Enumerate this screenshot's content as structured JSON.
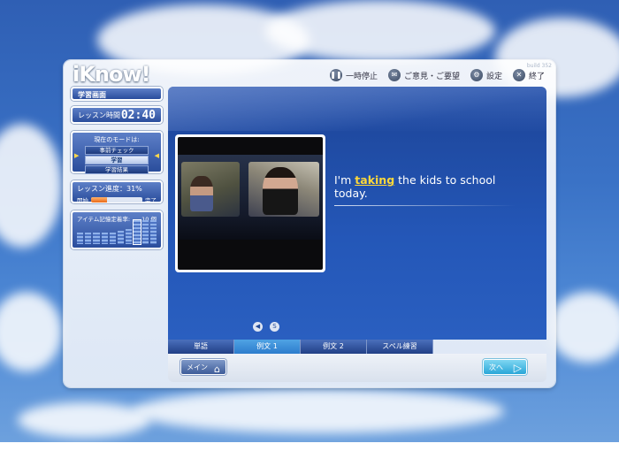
{
  "app": {
    "logo": "iKnow!",
    "build": "build 352"
  },
  "toolbar": [
    {
      "icon": "pause-icon",
      "glyph": "❚❚",
      "label": "一時停止"
    },
    {
      "icon": "feedback-icon",
      "glyph": "✉",
      "label": "ご意見・ご要望"
    },
    {
      "icon": "settings-icon",
      "glyph": "⚙",
      "label": "設定"
    },
    {
      "icon": "exit-icon",
      "glyph": "✕",
      "label": "終了"
    }
  ],
  "sidebar": {
    "title": "学習画面",
    "lesson_time_label": "レッスン時間",
    "lesson_time": "02:40",
    "mode_label": "現在のモードは:",
    "modes": [
      "事前チェック",
      "学習",
      "学習結果"
    ],
    "active_mode": 1,
    "progress_label": "レッスン進度：31%",
    "progress_percent": 31,
    "progress_start": "開始",
    "progress_end": "完了",
    "memory_label": "アイテム記憶定着率:",
    "memory_count": "10 個"
  },
  "lesson": {
    "sentence_before": "I'm ",
    "sentence_highlight": "taking",
    "sentence_after": " the kids to school today."
  },
  "tabs": [
    "単語",
    "例文 1",
    "例文 2",
    "スペル練習"
  ],
  "active_tab": 1,
  "buttons": {
    "main": "メイン",
    "next": "次へ"
  }
}
